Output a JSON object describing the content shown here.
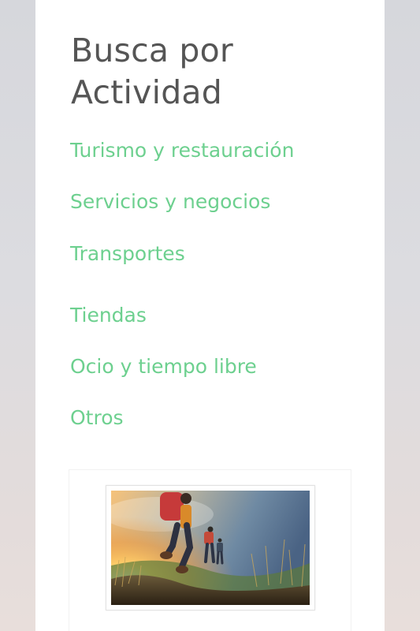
{
  "sidebar": {
    "heading": "Busca por Actividad",
    "categories": [
      {
        "label": "Turismo y restauración"
      },
      {
        "label": "Servicios y negocios"
      },
      {
        "label": "Transportes"
      },
      {
        "label": "Tiendas"
      },
      {
        "label": "Ocio y tiempo libre"
      },
      {
        "label": "Otros"
      }
    ]
  },
  "colors": {
    "accent": "#6dd08f",
    "heading": "#555555",
    "background": "#dcdce0"
  }
}
